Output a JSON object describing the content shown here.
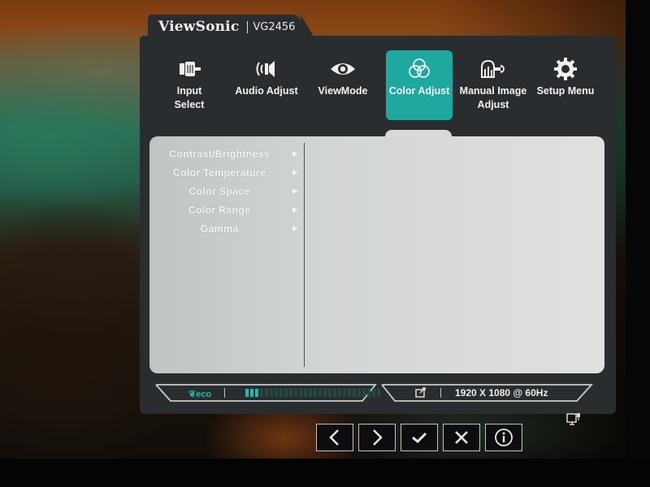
{
  "brand": {
    "name": "ViewSonic",
    "model": "VG2456"
  },
  "tabs": [
    {
      "id": "input-select",
      "label_line1": "Input",
      "label_line2": "Select",
      "icon": "input-connector-icon",
      "active": false
    },
    {
      "id": "audio-adjust",
      "label_line1": "Audio Adjust",
      "label_line2": "",
      "icon": "speaker-icon",
      "active": false
    },
    {
      "id": "viewmode",
      "label_line1": "ViewMode",
      "label_line2": "",
      "icon": "eye-icon",
      "active": false
    },
    {
      "id": "color-adjust",
      "label_line1": "Color Adjust",
      "label_line2": "",
      "icon": "color-circles-icon",
      "active": true
    },
    {
      "id": "manual-image-adjust",
      "label_line1": "Manual Image",
      "label_line2": "Adjust",
      "icon": "hand-wrench-icon",
      "active": false
    },
    {
      "id": "setup-menu",
      "label_line1": "Setup Menu",
      "label_line2": "",
      "icon": "gear-icon",
      "active": false
    }
  ],
  "submenu": [
    {
      "label": "Contrast/Brightness",
      "arrow": "▶"
    },
    {
      "label": "Color Temperature",
      "arrow": "▶"
    },
    {
      "label": "Color Space",
      "arrow": "▶"
    },
    {
      "label": "Color Range",
      "arrow": "▶"
    },
    {
      "label": "Gamma",
      "arrow": "▶"
    }
  ],
  "status": {
    "eco_label": "eco",
    "eco_level_segments_on": 3,
    "eco_level_segments_total": 28,
    "resolution": "1920 X 1080 @ 60Hz"
  },
  "controls": [
    {
      "id": "left",
      "icon": "chevron-left-icon"
    },
    {
      "id": "right",
      "icon": "chevron-right-icon"
    },
    {
      "id": "confirm",
      "icon": "checkmark-icon"
    },
    {
      "id": "close",
      "icon": "close-icon"
    },
    {
      "id": "info",
      "icon": "info-icon"
    }
  ],
  "colors": {
    "accent": "#1fa8a0",
    "osd_bg": "#2a2d30",
    "content_bg": "#d3d6d6",
    "eco_on": "#22b8ae"
  }
}
